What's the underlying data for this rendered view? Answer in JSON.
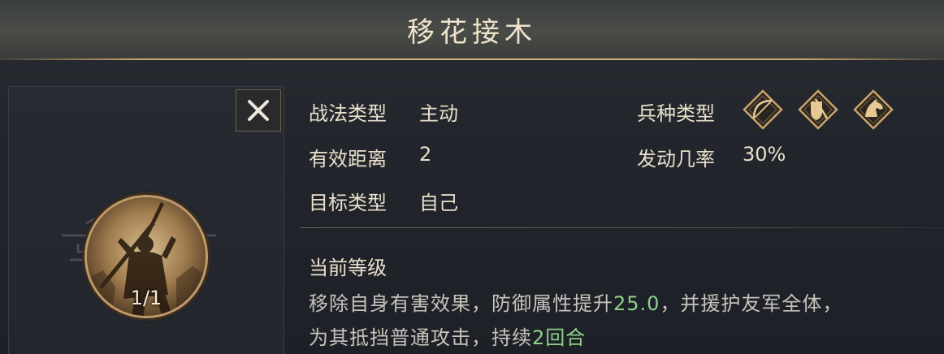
{
  "title": "移花接木",
  "skill": {
    "level": "1/1"
  },
  "info": {
    "tactic_type_label": "战法类型",
    "tactic_type_value": "主动",
    "range_label": "有效距离",
    "range_value": "2",
    "target_label": "目标类型",
    "target_value": "自己",
    "troop_type_label": "兵种类型",
    "troop_icons": [
      "bow-icon",
      "shield-icon",
      "horse-icon"
    ],
    "trigger_rate_label": "发动几率",
    "trigger_rate_value": "30%"
  },
  "description": {
    "title": "当前等级",
    "line1_a": "移除自身有害效果，防御属性提升",
    "line1_hl": "25.0",
    "line1_b": "，并援护友军全体，",
    "line2_a": "为其抵挡普通攻击，持续",
    "line2_hl": "2回合"
  },
  "colors": {
    "highlight": "#8fcf8a",
    "gold": "#c8a66e"
  }
}
